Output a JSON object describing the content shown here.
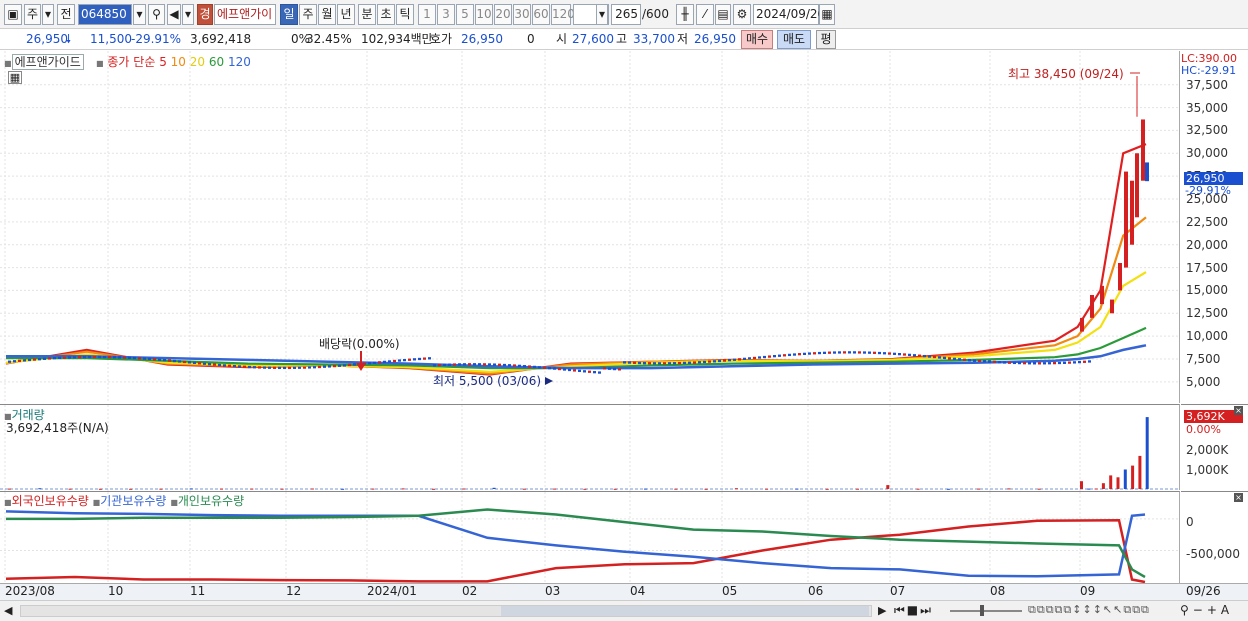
{
  "toolbar": {
    "chart_type": "주",
    "compare": "전",
    "stock_code": "064850",
    "warning_badge": "경",
    "stock_name": "에프앤가이",
    "periods": [
      "일",
      "주",
      "월",
      "년",
      "분",
      "초",
      "틱"
    ],
    "active_period": "일",
    "intervals": [
      "1",
      "3",
      "5",
      "10",
      "20",
      "30",
      "60",
      "120"
    ],
    "count": "265",
    "count_max": "/600",
    "date": "2024/09/26"
  },
  "quote": {
    "price": "26,950",
    "change": "11,500",
    "change_pct": "-29.91%",
    "volume": "3,692,418",
    "turnover_ratio": "0%",
    "ratio2": "32.45%",
    "trade_value": "102,934백만",
    "bid_label": "호가",
    "bid": "26,950",
    "bid_qty": "0",
    "open_label": "시",
    "open": "27,600",
    "high_label": "고",
    "high": "33,700",
    "low_label": "저",
    "low": "26,950",
    "buy_label": "매수",
    "sell_label": "매도",
    "eval_label": "평"
  },
  "price_panel": {
    "title": "에프앤가이드",
    "ma_label": "종가 단순",
    "ma_periods": [
      "5",
      "10",
      "20",
      "60",
      "120"
    ],
    "ma_colors": [
      "#e02020",
      "#f08a10",
      "#f3e011",
      "#2a9a3a",
      "#3564d4"
    ],
    "limit_high": "LC:390.00",
    "limit_low": "HC:-29.91",
    "max_note": "최고 38,450 (09/24)",
    "min_note": "최저 5,500 (03/06)",
    "dividend_note": "배당락(0.00%)",
    "current_price": "26,950",
    "current_pct": "-29.91%"
  },
  "volume_panel": {
    "title": "거래량",
    "value": "3,692,418주(N/A)",
    "current": "3,692K",
    "current_pct": "0.00%",
    "ticks": [
      "2,000K",
      "1,000K"
    ]
  },
  "holding_panel": {
    "legend": [
      "외국인보유수량",
      "기관보유수량",
      "개인보유수량"
    ],
    "colors": [
      "#d42020",
      "#3564d4",
      "#2a8a50"
    ],
    "ticks": [
      "0",
      "-500,000"
    ]
  },
  "x_axis": [
    "2023/08",
    "10",
    "11",
    "12",
    "2024/01",
    "02",
    "03",
    "04",
    "05",
    "06",
    "07",
    "08",
    "09",
    "09/26"
  ],
  "chart_data": [
    {
      "type": "line",
      "title": "에프앤가이드",
      "ylim": [
        4000,
        39000
      ],
      "y_ticks": [
        5000,
        7500,
        10000,
        12500,
        15000,
        17500,
        20000,
        22500,
        25000,
        27500,
        30000,
        32500,
        35000,
        37500
      ],
      "series": [
        {
          "name": "5",
          "values": [
            7000,
            8500,
            6900,
            6600,
            6800,
            6500,
            5800,
            7000,
            7200,
            7400,
            7300,
            7500,
            8200,
            9500,
            11000,
            15000,
            30000,
            31000
          ]
        },
        {
          "name": "10",
          "values": [
            7050,
            8300,
            7000,
            6700,
            6800,
            6550,
            5900,
            6900,
            7200,
            7350,
            7300,
            7450,
            8000,
            9000,
            10000,
            13000,
            21000,
            23000
          ]
        },
        {
          "name": "20",
          "values": [
            7100,
            8000,
            7100,
            6800,
            6800,
            6600,
            6100,
            6700,
            7100,
            7300,
            7250,
            7400,
            7800,
            8500,
            9300,
            11000,
            15500,
            17000
          ]
        },
        {
          "name": "60",
          "values": [
            7600,
            7600,
            7300,
            7000,
            6900,
            6800,
            6500,
            6500,
            6800,
            7000,
            7100,
            7200,
            7400,
            7700,
            8000,
            8700,
            9800,
            10900
          ]
        },
        {
          "name": "120",
          "values": [
            7800,
            7800,
            7600,
            7400,
            7200,
            7000,
            6700,
            6500,
            6500,
            6700,
            6900,
            7000,
            7100,
            7300,
            7500,
            7800,
            8500,
            9000
          ]
        }
      ]
    },
    {
      "type": "bar",
      "title": "거래량",
      "ylim": [
        0,
        3700000
      ],
      "values": [
        20000,
        40000,
        15000,
        12000,
        10000,
        15000,
        30000,
        20000,
        20000,
        15000,
        25000,
        10000,
        20000,
        30000,
        10000,
        25000,
        60000,
        15000,
        20000,
        10000,
        10000,
        20000,
        15000,
        10000,
        40000,
        15000,
        20000,
        10000,
        15000,
        200000,
        15000,
        10000,
        20000,
        30000,
        15000,
        400000,
        20000,
        25000,
        300000,
        700000,
        600000,
        1000000,
        1200000,
        1700000,
        3692418
      ]
    },
    {
      "type": "line",
      "title": "보유수량",
      "ylim": [
        -1000000,
        300000
      ],
      "series": [
        {
          "name": "외국인보유수량",
          "values": [
            -950000,
            -920000,
            -960000,
            -960000,
            -970000,
            -975000,
            -990000,
            -990000,
            -780000,
            -720000,
            -700000,
            -500000,
            -330000,
            -250000,
            -120000,
            -30000,
            -20000,
            -960000,
            -1000000
          ]
        },
        {
          "name": "기관보유수량",
          "values": [
            120000,
            90000,
            80000,
            60000,
            50000,
            50000,
            50000,
            -300000,
            -420000,
            -520000,
            -600000,
            -700000,
            -780000,
            -800000,
            -900000,
            -910000,
            -880000,
            50000,
            70000
          ]
        },
        {
          "name": "개인보유수량",
          "values": [
            0,
            0,
            20000,
            20000,
            20000,
            30000,
            50000,
            150000,
            70000,
            -50000,
            -170000,
            -200000,
            -270000,
            -330000,
            -360000,
            -390000,
            -420000,
            -800000,
            -920000
          ]
        }
      ]
    }
  ]
}
